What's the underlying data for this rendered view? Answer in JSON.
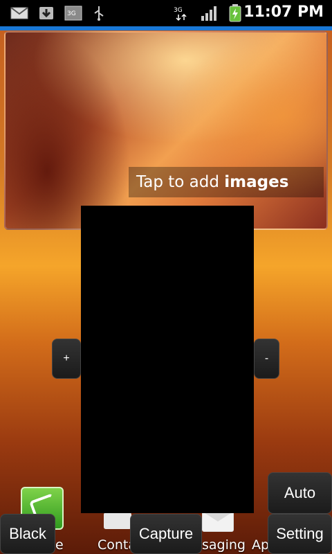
{
  "status_bar": {
    "time": "11:07 PM",
    "network_label": "3G",
    "icons": [
      "email-icon",
      "download-icon",
      "3g-icon",
      "usb-icon",
      "3g-data-icon",
      "signal-icon",
      "battery-charging-icon"
    ]
  },
  "widget": {
    "tap_text_prefix": "Tap to add ",
    "tap_text_bold": "images"
  },
  "controls": {
    "zoom_in": "+",
    "zoom_out": "-",
    "auto": "Auto",
    "black": "Black",
    "capture": "Capture",
    "setting": "Setting"
  },
  "dock": {
    "phone_label_fragment": "e",
    "contacts_label_fragment": "Conta",
    "messaging_label_fragment": "saging",
    "apps_label_fragment": "Ap"
  },
  "colors": {
    "status_bar_bg": "#000000",
    "accent_blue": "#1a78d6",
    "button_bg": "#222222"
  }
}
